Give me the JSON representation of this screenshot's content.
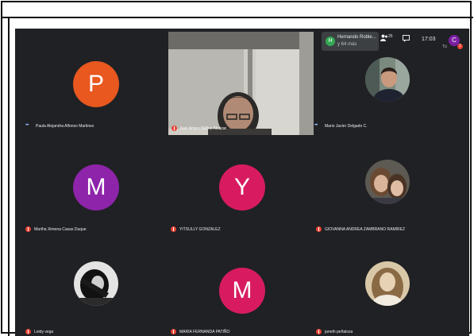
{
  "toast": {
    "name": "Hernando Roble...",
    "more": "y 64 más",
    "initial": "H"
  },
  "topbar": {
    "people_count": "25",
    "time": "17:03",
    "you_label": "Tú",
    "user_initial": "C",
    "badge": "1"
  },
  "colors": {
    "background": "#202124",
    "orange": "#e8581f",
    "purple": "#8e24aa",
    "pink": "#d81b60",
    "mute": "#ea4335"
  },
  "participants": [
    {
      "name": "Paula Alejandra Alfonso Martinez",
      "initial": "P",
      "status": "speaking"
    },
    {
      "name": "Juan Arturo Núñez Alcázar",
      "status": "muted"
    },
    {
      "name": "Mario Javier Delgado C.",
      "status": "speaking"
    },
    {
      "name": "Martha Ximena Casas Duque",
      "initial": "M",
      "status": "muted"
    },
    {
      "name": "YITSULLY GONZALEZ",
      "initial": "Y",
      "status": "muted"
    },
    {
      "name": "GIOVANNA ANDREA ZAMBRANO RAMIREZ",
      "status": "muted"
    },
    {
      "name": "Leidy vega",
      "status": "muted"
    },
    {
      "name": "MARIA FERNANDA PATIÑO",
      "initial": "M",
      "status": "muted"
    },
    {
      "name": "janeth peñaloza",
      "status": "muted"
    }
  ]
}
